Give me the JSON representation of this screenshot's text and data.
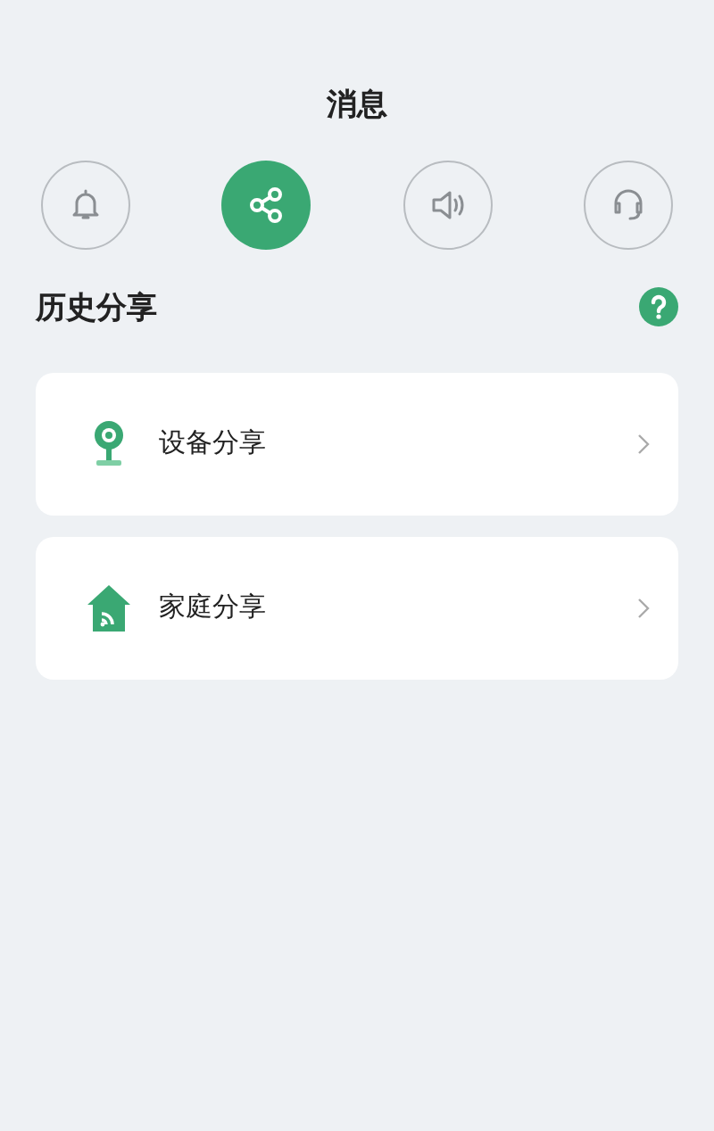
{
  "header": {
    "title": "消息"
  },
  "tabs": [
    {
      "kind": "bell",
      "selected": false
    },
    {
      "kind": "share",
      "selected": true
    },
    {
      "kind": "speaker",
      "selected": false
    },
    {
      "kind": "headset",
      "selected": false
    }
  ],
  "section": {
    "title": "历史分享"
  },
  "items": [
    {
      "kind": "camera",
      "label": "设备分享"
    },
    {
      "kind": "home",
      "label": "家庭分享"
    }
  ]
}
